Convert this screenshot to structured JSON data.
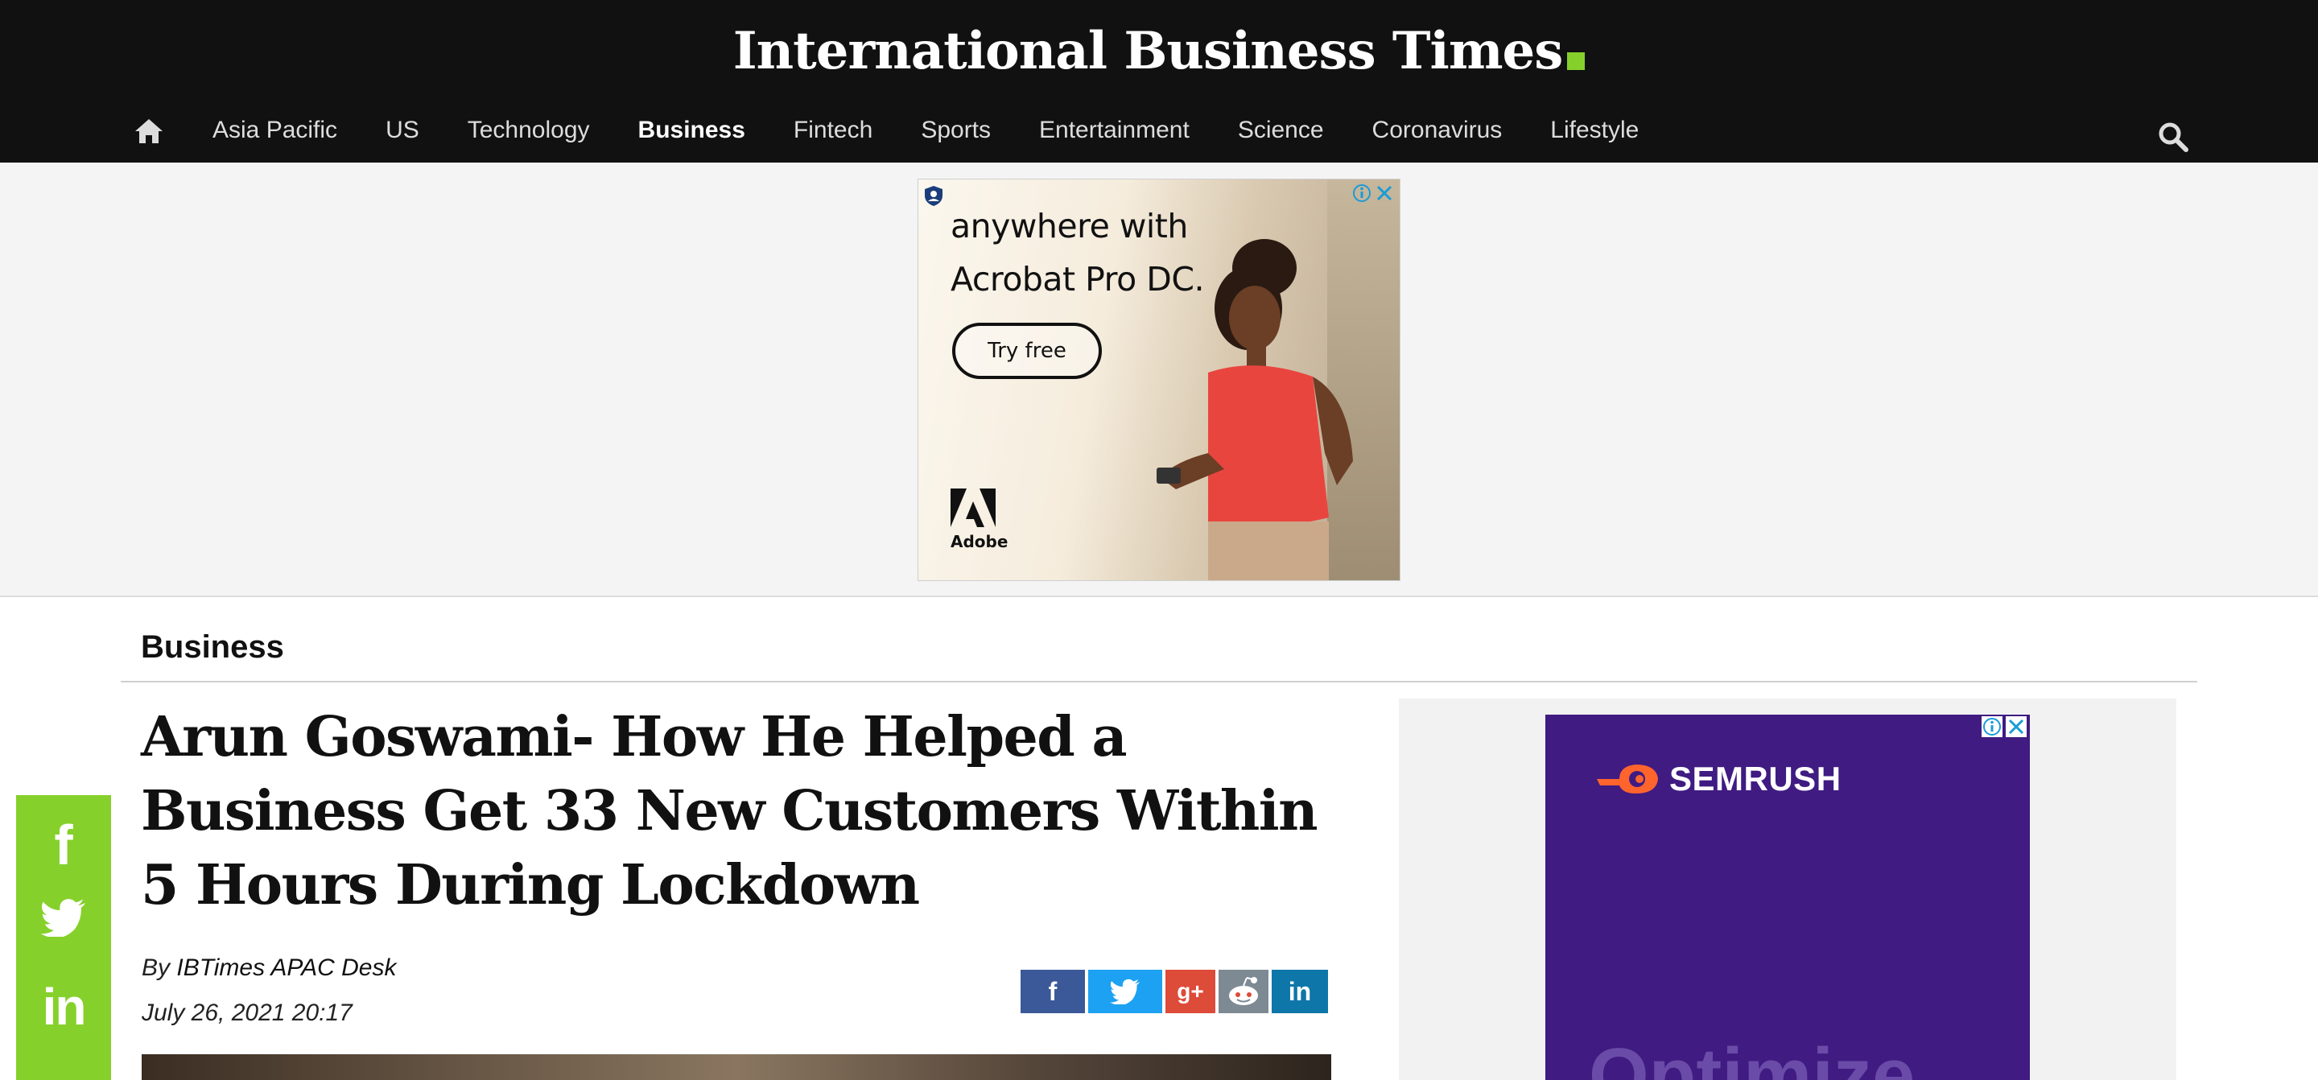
{
  "header": {
    "logo_text": "International Business Times",
    "logo_dot_color": "#86d02c",
    "nav": {
      "home_icon": "home-icon",
      "items": [
        {
          "label": "Asia Pacific",
          "active": false
        },
        {
          "label": "US",
          "active": false
        },
        {
          "label": "Technology",
          "active": false
        },
        {
          "label": "Business",
          "active": true
        },
        {
          "label": "Fintech",
          "active": false
        },
        {
          "label": "Sports",
          "active": false
        },
        {
          "label": "Entertainment",
          "active": false
        },
        {
          "label": "Science",
          "active": false
        },
        {
          "label": "Coronavirus",
          "active": false
        },
        {
          "label": "Lifestyle",
          "active": false
        }
      ],
      "search_icon": "search-icon"
    }
  },
  "top_ad": {
    "line1": "anywhere with",
    "line2": "Acrobat Pro DC.",
    "cta_label": "Try free",
    "brand": "Adobe"
  },
  "section": {
    "label": "Business"
  },
  "article": {
    "headline": "Arun Goswami- How He Helped a Business Get 33 New Customers Within 5 Hours During Lockdown",
    "byline_prefix": "By ",
    "author": "IBTimes APAC Desk",
    "date": "July 26, 2021 20:17",
    "share_buttons": [
      {
        "network": "facebook",
        "glyph": "f",
        "color": "#3b5998"
      },
      {
        "network": "twitter",
        "glyph": "twitter-bird-icon",
        "color": "#1da1f2"
      },
      {
        "network": "google-plus",
        "glyph": "g+",
        "color": "#dd4b39"
      },
      {
        "network": "reddit",
        "glyph": "reddit-icon",
        "color": "#7d8a94"
      },
      {
        "network": "linkedin",
        "glyph": "in",
        "color": "#0e76a8"
      }
    ]
  },
  "sticky_share": {
    "color": "#86d02c",
    "facebook_glyph": "f",
    "linkedin_glyph": "in"
  },
  "right_ad": {
    "brand": "SEMRUSH",
    "partial_text": "Optimize",
    "background_color": "#3f1b82"
  }
}
